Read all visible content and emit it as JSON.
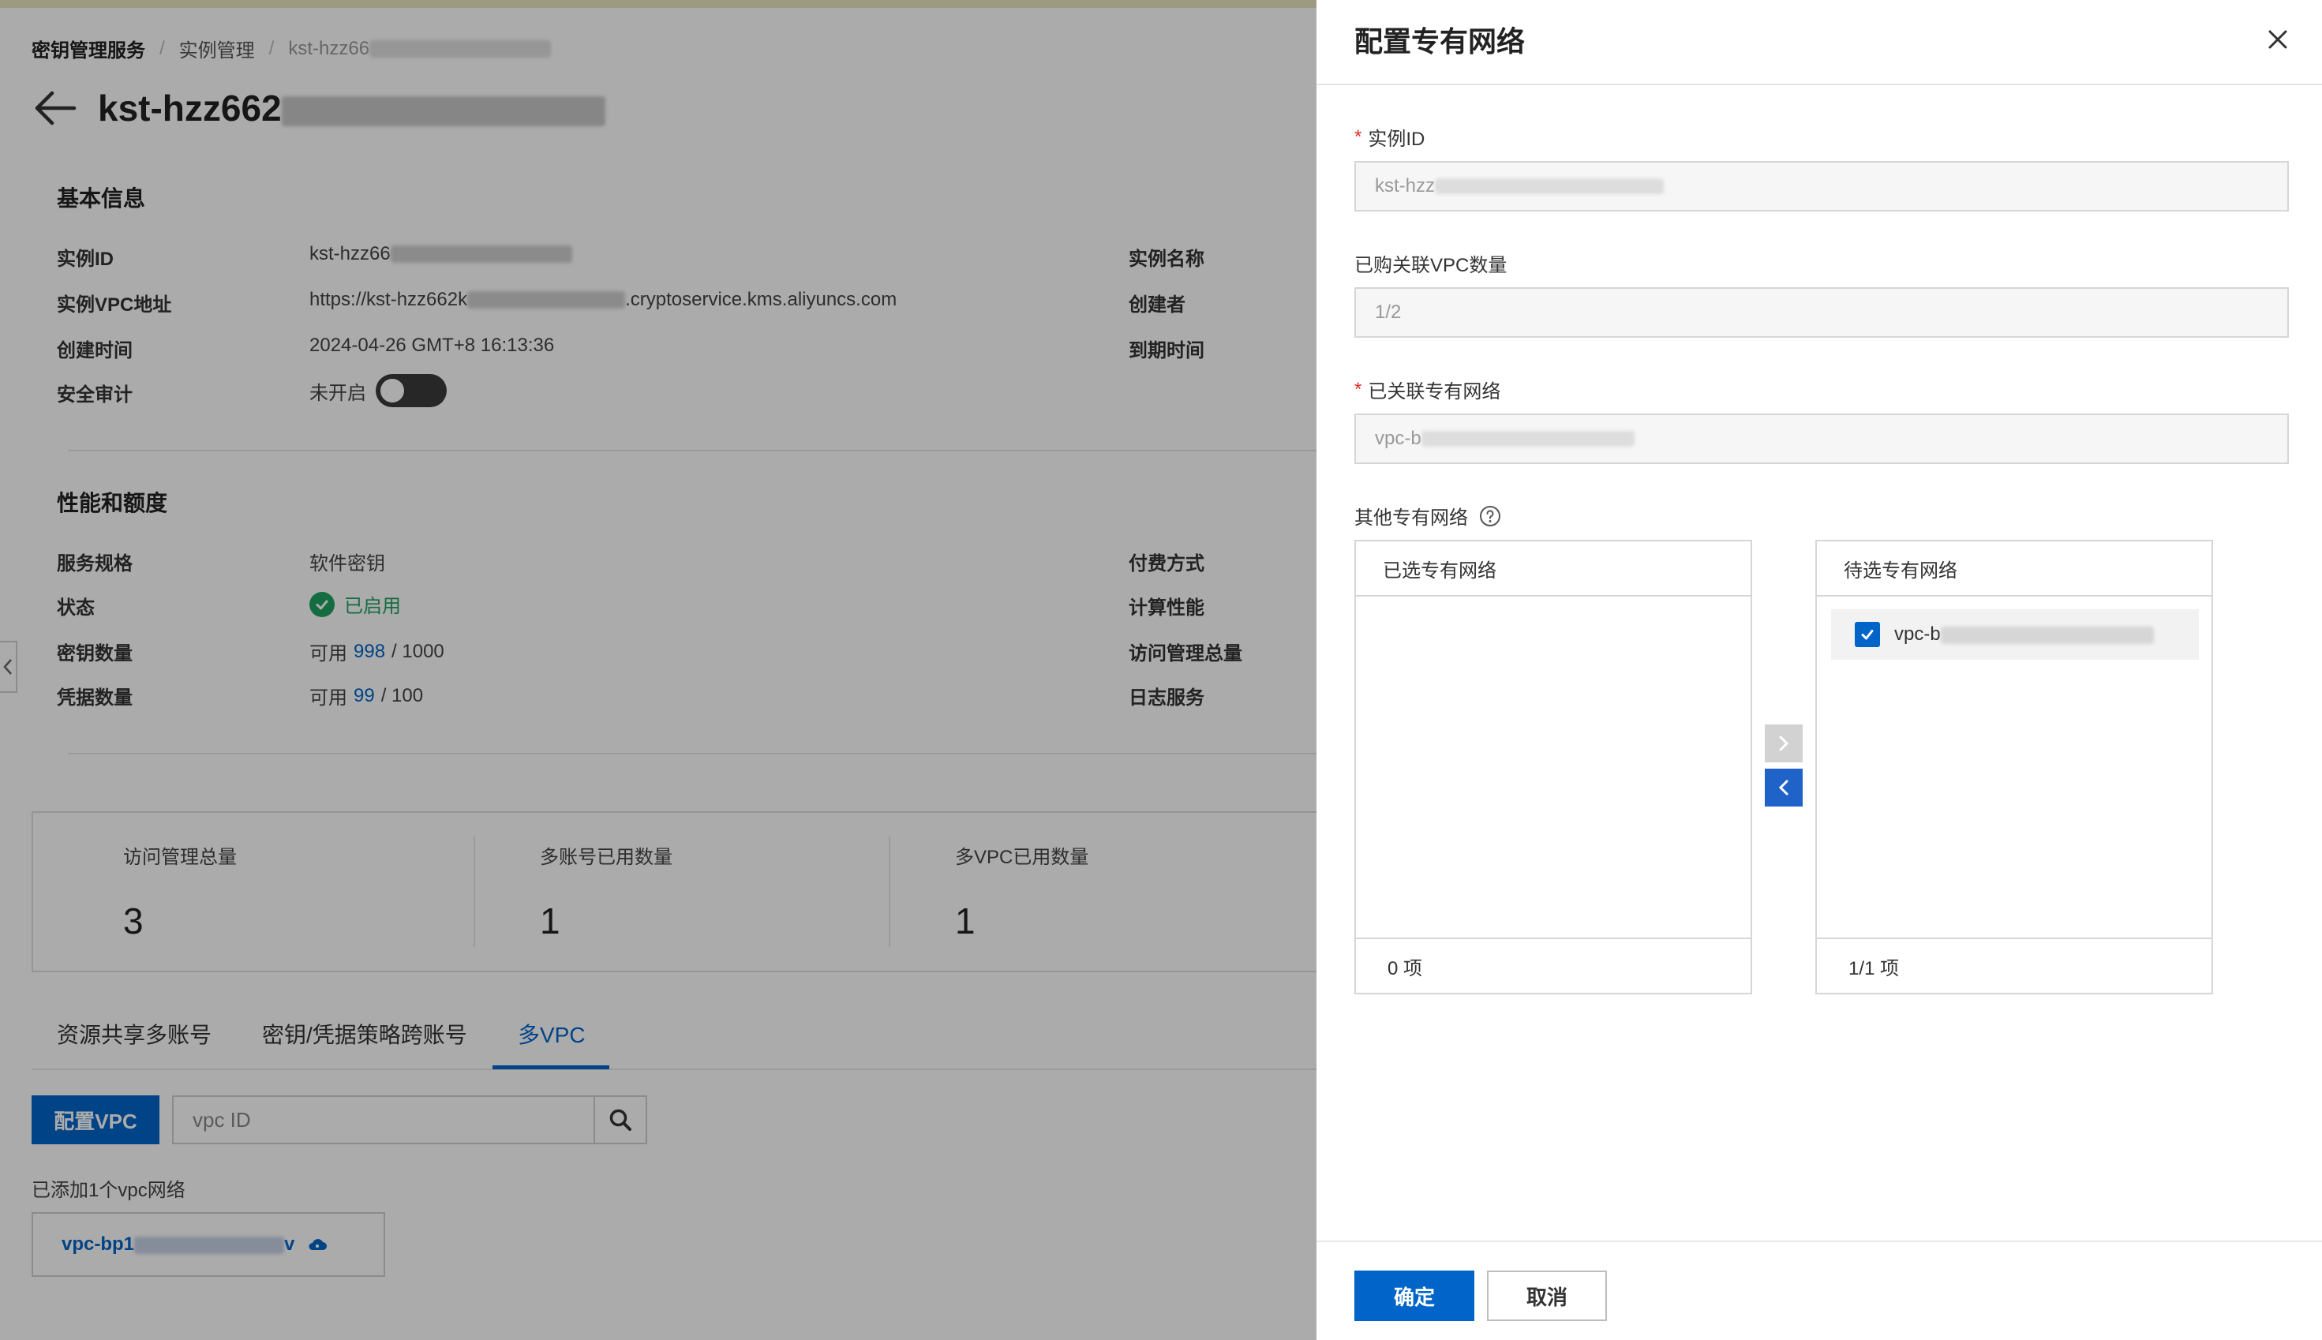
{
  "breadcrumb": {
    "root": "密钥管理服务",
    "parent": "实例管理",
    "current_prefix": "kst-hzz66"
  },
  "header": {
    "title_prefix": "kst-hzz662"
  },
  "basic_info": {
    "section_title": "基本信息",
    "rows": [
      {
        "label": "实例ID",
        "value": "kst-hzz66"
      },
      {
        "label": "实例VPC地址",
        "value_prefix": "https://kst-hzz662k",
        "value_suffix": ".cryptoservice.kms.aliyuncs.com"
      },
      {
        "label": "创建时间",
        "value": "2024-04-26 GMT+8 16:13:36"
      },
      {
        "label": "安全审计",
        "value": "未开启"
      }
    ],
    "right_labels": [
      "实例名称",
      "创建者",
      "到期时间"
    ]
  },
  "performance": {
    "section_title": "性能和额度",
    "rows": [
      {
        "label": "服务规格",
        "value": "软件密钥"
      },
      {
        "label": "状态",
        "value": "已启用"
      },
      {
        "label": "密钥数量",
        "prefix": "可用",
        "available": "998",
        "total": "/ 1000"
      },
      {
        "label": "凭据数量",
        "prefix": "可用",
        "available": "99",
        "total": "/ 100"
      }
    ],
    "right_labels": [
      "付费方式",
      "计算性能",
      "访问管理总量",
      "日志服务"
    ]
  },
  "stats": [
    {
      "label": "访问管理总量",
      "value": "3"
    },
    {
      "label": "多账号已用数量",
      "value": "1"
    },
    {
      "label": "多VPC已用数量",
      "value": "1"
    }
  ],
  "tabs": [
    {
      "label": "资源共享多账号"
    },
    {
      "label": "密钥/凭据策略跨账号"
    },
    {
      "label": "多VPC"
    }
  ],
  "vpc_section": {
    "config_button": "配置VPC",
    "search_placeholder": "vpc ID",
    "added_text": "已添加1个vpc网络",
    "card_link_prefix": "vpc-bp1",
    "card_link_suffix": "v"
  },
  "drawer": {
    "title": "配置专有网络",
    "instance_id_label": "实例ID",
    "instance_id_value": "kst-hzz",
    "vpc_count_label": "已购关联VPC数量",
    "vpc_count_value": "1/2",
    "linked_vpc_label": "已关联专有网络",
    "linked_vpc_value": "vpc-b",
    "other_vpc_label": "其他专有网络",
    "selected_panel": {
      "title": "已选专有网络",
      "footer": "0 项"
    },
    "candidate_panel": {
      "title": "待选专有网络",
      "footer": "1/1 项",
      "item_prefix": "vpc-b"
    },
    "ok_button": "确定",
    "cancel_button": "取消"
  },
  "colors": {
    "primary": "#0064c8",
    "success": "#1ea362",
    "required": "#d93026"
  }
}
